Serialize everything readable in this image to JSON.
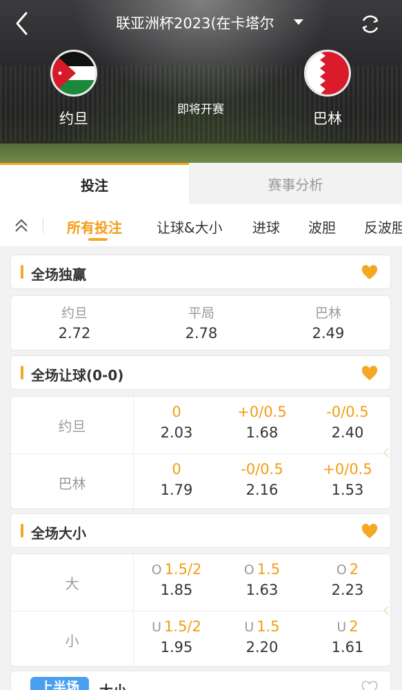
{
  "header": {
    "title": "联亚洲杯2023(在卡塔尔",
    "status": "即将开赛",
    "home_team": "约旦",
    "away_team": "巴林"
  },
  "main_tabs": [
    {
      "label": "投注",
      "active": true
    },
    {
      "label": "赛事分析",
      "active": false
    }
  ],
  "filters": [
    {
      "label": "所有投注",
      "active": true
    },
    {
      "label": "让球&大小",
      "active": false
    },
    {
      "label": "进球",
      "active": false
    },
    {
      "label": "波胆",
      "active": false
    },
    {
      "label": "反波胆",
      "active": false
    }
  ],
  "sections": {
    "fulltime_1x2": {
      "title": "全场独赢",
      "options": [
        {
          "name": "约旦",
          "odd": "2.72"
        },
        {
          "name": "平局",
          "odd": "2.78"
        },
        {
          "name": "巴林",
          "odd": "2.49"
        }
      ]
    },
    "fulltime_handicap": {
      "title": "全场让球(0-0)",
      "rows": [
        {
          "team": "约旦",
          "cells": [
            {
              "line": "0",
              "price": "2.03"
            },
            {
              "line": "+0/0.5",
              "price": "1.68"
            },
            {
              "line": "-0/0.5",
              "price": "2.40"
            }
          ]
        },
        {
          "team": "巴林",
          "cells": [
            {
              "line": "0",
              "price": "1.79"
            },
            {
              "line": "-0/0.5",
              "price": "2.16"
            },
            {
              "line": "+0/0.5",
              "price": "1.53"
            }
          ]
        }
      ]
    },
    "fulltime_over_under": {
      "title": "全场大小",
      "rows": [
        {
          "team": "大",
          "cells": [
            {
              "prefix": "O",
              "line": "1.5/2",
              "price": "1.85"
            },
            {
              "prefix": "O",
              "line": "1.5",
              "price": "1.63"
            },
            {
              "prefix": "O",
              "line": "2",
              "price": "2.23"
            }
          ]
        },
        {
          "team": "小",
          "cells": [
            {
              "prefix": "U",
              "line": "1.5/2",
              "price": "1.95"
            },
            {
              "prefix": "U",
              "line": "1.5",
              "price": "2.20"
            },
            {
              "prefix": "U",
              "line": "2",
              "price": "1.61"
            }
          ]
        }
      ]
    },
    "firsthalf_over_under": {
      "tag": "上半场",
      "title": "大小"
    }
  },
  "colors": {
    "accent": "#f5a623",
    "odds_line": "#f39c12",
    "half_tag": "#4a9ff0"
  },
  "icons": {
    "back": "chevron-left-icon",
    "dropdown": "caret-down-icon",
    "refresh": "refresh-icon",
    "collapse": "double-chevron-up-icon",
    "favorite": "heart-icon"
  }
}
